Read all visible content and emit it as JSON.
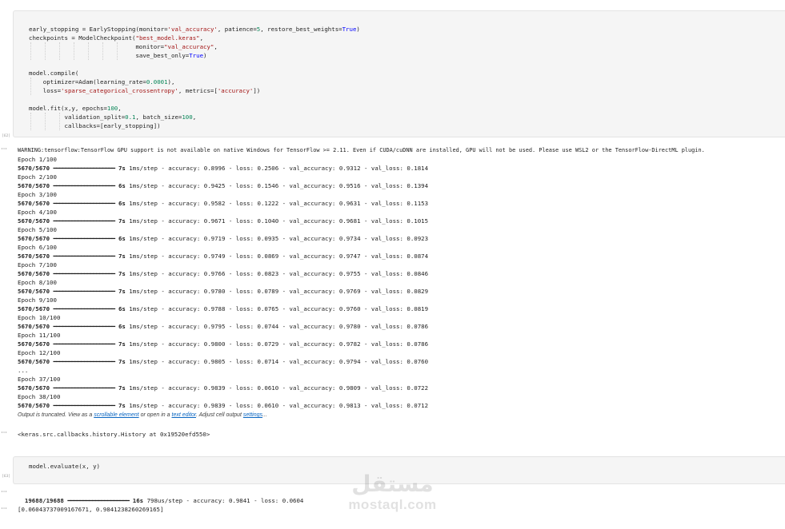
{
  "cell1": {
    "exec_count": "[62]",
    "code_lines": [
      {
        "html": "early_stopping = EarlyStopping(monitor=<span class='tk-str'>'val_accuracy'</span>, patience=<span class='tk-num'>5</span>, restore_best_weights=<span class='tk-kw'>True</span>)"
      },
      {
        "html": "checkpoints = ModelCheckpoint(<span class='tk-str'>\"best_model.keras\"</span>,"
      },
      {
        "html": "                              monitor=<span class='tk-str'>\"val_accuracy\"</span>,"
      },
      {
        "html": "                              save_best_only=<span class='tk-kw'>True</span>)"
      },
      {
        "html": ""
      },
      {
        "html": "model.compile("
      },
      {
        "html": "    optimizer=Adam(learning_rate=<span class='tk-num'>0.0001</span>),"
      },
      {
        "html": "    loss=<span class='tk-str'>'sparse_categorical_crossentropy'</span>, metrics=[<span class='tk-str'>'accuracy'</span>])"
      },
      {
        "html": ""
      },
      {
        "html": "model.fit(x,y, epochs=<span class='tk-num'>100</span>,"
      },
      {
        "html": "          validation_split=<span class='tk-num'>0.1</span>, batch_size=<span class='tk-num'>100</span>,"
      },
      {
        "html": "          callbacks=[early_stopping])"
      }
    ],
    "warning": "WARNING:tensorflow:TensorFlow GPU support is not available on native Windows for TensorFlow >= 2.11. Even if CUDA/cuDNN are installed, GPU will not be used. Please use WSL2 or the TensorFlow-DirectML plugin.",
    "epochs": [
      {
        "epoch": "Epoch 1/100",
        "steps": "5670/5670",
        "time": "7s",
        "per_step": "1ms/step",
        "accuracy": "0.8996",
        "loss": "0.2506",
        "val_accuracy": "0.9312",
        "val_loss": "0.1814"
      },
      {
        "epoch": "Epoch 2/100",
        "steps": "5670/5670",
        "time": "6s",
        "per_step": "1ms/step",
        "accuracy": "0.9425",
        "loss": "0.1546",
        "val_accuracy": "0.9516",
        "val_loss": "0.1394"
      },
      {
        "epoch": "Epoch 3/100",
        "steps": "5670/5670",
        "time": "6s",
        "per_step": "1ms/step",
        "accuracy": "0.9582",
        "loss": "0.1222",
        "val_accuracy": "0.9631",
        "val_loss": "0.1153"
      },
      {
        "epoch": "Epoch 4/100",
        "steps": "5670/5670",
        "time": "7s",
        "per_step": "1ms/step",
        "accuracy": "0.9671",
        "loss": "0.1040",
        "val_accuracy": "0.9681",
        "val_loss": "0.1015"
      },
      {
        "epoch": "Epoch 5/100",
        "steps": "5670/5670",
        "time": "6s",
        "per_step": "1ms/step",
        "accuracy": "0.9719",
        "loss": "0.0935",
        "val_accuracy": "0.9734",
        "val_loss": "0.0923"
      },
      {
        "epoch": "Epoch 6/100",
        "steps": "5670/5670",
        "time": "7s",
        "per_step": "1ms/step",
        "accuracy": "0.9749",
        "loss": "0.0869",
        "val_accuracy": "0.9747",
        "val_loss": "0.0874"
      },
      {
        "epoch": "Epoch 7/100",
        "steps": "5670/5670",
        "time": "7s",
        "per_step": "1ms/step",
        "accuracy": "0.9766",
        "loss": "0.0823",
        "val_accuracy": "0.9755",
        "val_loss": "0.0846"
      },
      {
        "epoch": "Epoch 8/100",
        "steps": "5670/5670",
        "time": "7s",
        "per_step": "1ms/step",
        "accuracy": "0.9780",
        "loss": "0.0789",
        "val_accuracy": "0.9769",
        "val_loss": "0.0829"
      },
      {
        "epoch": "Epoch 9/100",
        "steps": "5670/5670",
        "time": "6s",
        "per_step": "1ms/step",
        "accuracy": "0.9788",
        "loss": "0.0765",
        "val_accuracy": "0.9760",
        "val_loss": "0.0819"
      },
      {
        "epoch": "Epoch 10/100",
        "steps": "5670/5670",
        "time": "6s",
        "per_step": "1ms/step",
        "accuracy": "0.9795",
        "loss": "0.0744",
        "val_accuracy": "0.9780",
        "val_loss": "0.0786"
      },
      {
        "epoch": "Epoch 11/100",
        "steps": "5670/5670",
        "time": "7s",
        "per_step": "1ms/step",
        "accuracy": "0.9800",
        "loss": "0.0729",
        "val_accuracy": "0.9782",
        "val_loss": "0.0786"
      },
      {
        "epoch": "Epoch 12/100",
        "steps": "5670/5670",
        "time": "7s",
        "per_step": "1ms/step",
        "accuracy": "0.9805",
        "loss": "0.0714",
        "val_accuracy": "0.9794",
        "val_loss": "0.0760"
      },
      {
        "ellipsis": "..."
      },
      {
        "epoch": "Epoch 37/100",
        "steps": "5670/5670",
        "time": "7s",
        "per_step": "1ms/step",
        "accuracy": "0.9839",
        "loss": "0.0610",
        "val_accuracy": "0.9809",
        "val_loss": "0.0722"
      },
      {
        "epoch": "Epoch 38/100",
        "steps": "5670/5670",
        "time": "7s",
        "per_step": "1ms/step",
        "accuracy": "0.9839",
        "loss": "0.0610",
        "val_accuracy": "0.9813",
        "val_loss": "0.0712"
      }
    ],
    "truncated": {
      "prefix": "Output is truncated. View as a ",
      "link1": "scrollable element",
      "mid": " or open in a ",
      "link2": "text editor",
      "mid2": ". Adjust cell output ",
      "link3": "settings",
      "suffix": "..."
    },
    "result": "<keras.src.callbacks.history.History at 0x19520efd550>"
  },
  "cell2": {
    "exec_count": "[63]",
    "code": "model.evaluate(x, y)",
    "progress": {
      "steps": "19688/19688",
      "time": "16s",
      "per_step": "798us/step",
      "accuracy": "0.9841",
      "loss": "0.0604"
    },
    "result": "[0.06043737009167671, 0.9841238260269165]"
  },
  "watermark": {
    "arabic": "مستقل",
    "latin": "mostaql.com"
  }
}
